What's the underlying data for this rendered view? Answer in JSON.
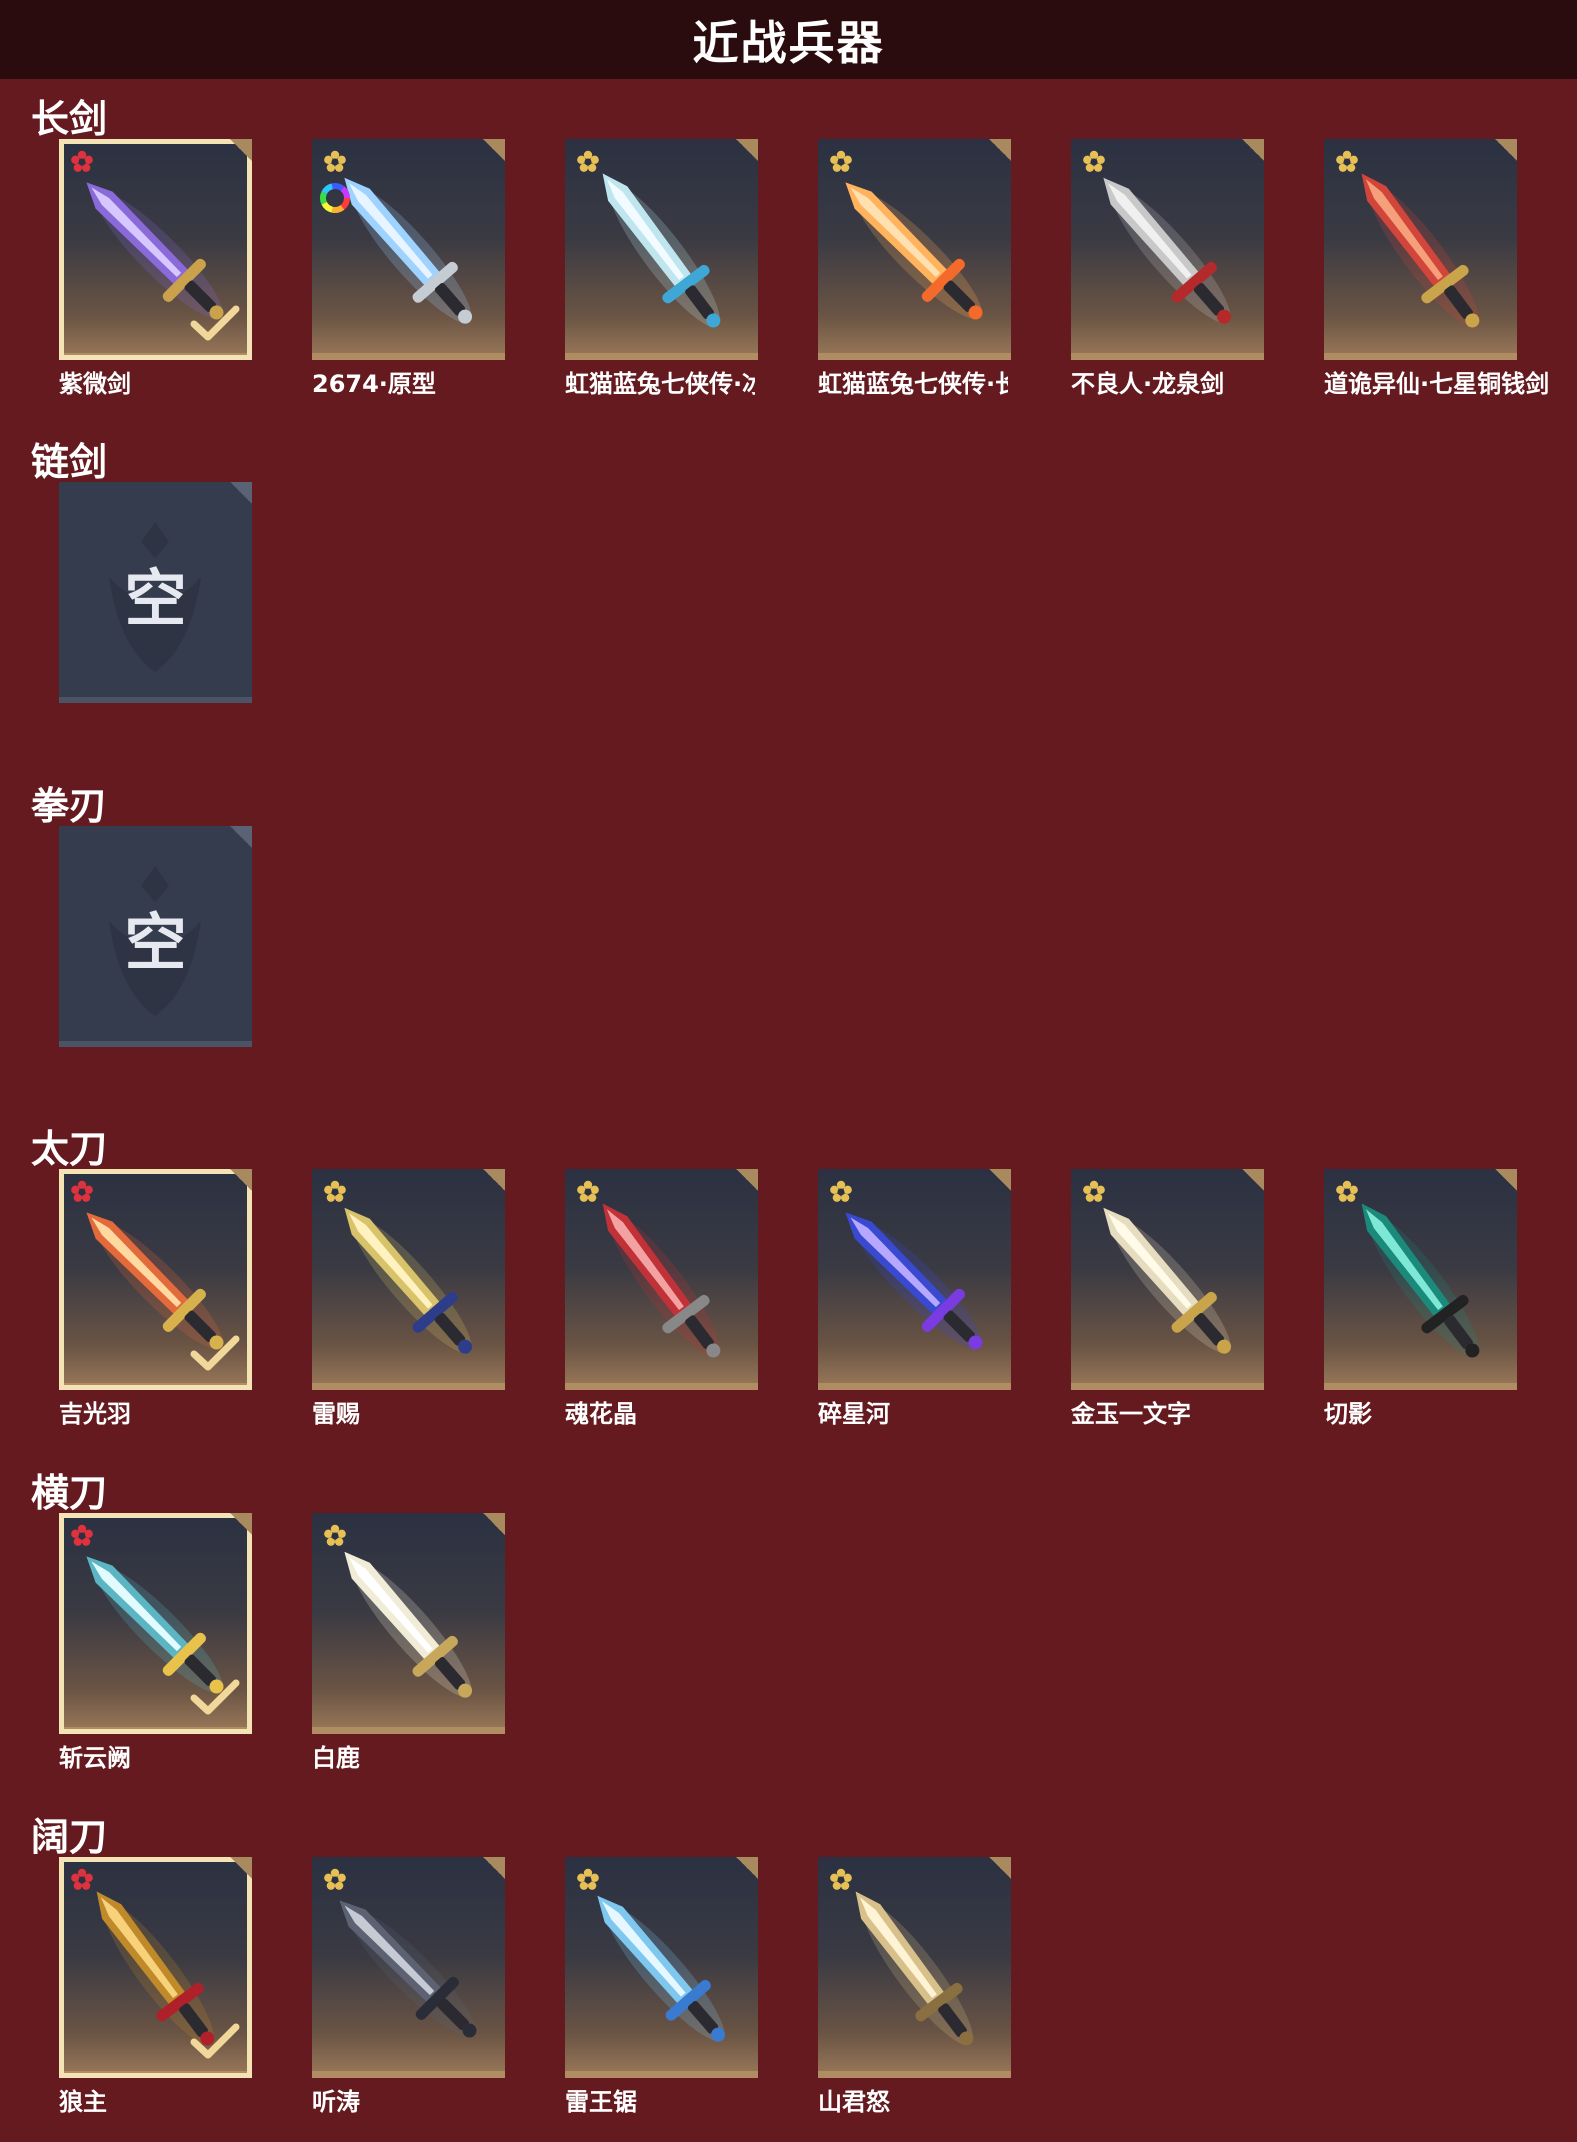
{
  "header": {
    "title": "近战兵器"
  },
  "colors": {
    "background": "#641a1f",
    "header": "#2b0c0e",
    "selected_frame": "#f4e3b5",
    "card_bottom": "#b08c62"
  },
  "sections": [
    {
      "title": "长剑",
      "items": [
        {
          "label": "紫微剑",
          "selected": true,
          "rank_icon": "red-flower-icon"
        },
        {
          "label": "2674·原型",
          "selected": false,
          "rank_icon": "gold-flower-icon",
          "has_color_wheel": true
        },
        {
          "label": "虹猫蓝兔七侠传·冰魄剑",
          "selected": false,
          "rank_icon": "gold-flower-icon"
        },
        {
          "label": "虹猫蓝兔七侠传·长虹剑",
          "selected": false,
          "rank_icon": "gold-flower-icon"
        },
        {
          "label": "不良人·龙泉剑",
          "selected": false,
          "rank_icon": "gold-flower-icon"
        },
        {
          "label": "道诡异仙·七星铜钱剑",
          "selected": false,
          "rank_icon": "gold-flower-icon"
        }
      ]
    },
    {
      "title": "链剑",
      "empty_label": "空",
      "items": []
    },
    {
      "title": "拳刃",
      "empty_label": "空",
      "items": []
    },
    {
      "title": "太刀",
      "items": [
        {
          "label": "吉光羽",
          "selected": true,
          "rank_icon": "red-flower-icon"
        },
        {
          "label": "雷赐",
          "selected": false,
          "rank_icon": "gold-flower-icon"
        },
        {
          "label": "魂花晶",
          "selected": false,
          "rank_icon": "gold-flower-icon"
        },
        {
          "label": "碎星河",
          "selected": false,
          "rank_icon": "gold-flower-icon"
        },
        {
          "label": "金玉一文字",
          "selected": false,
          "rank_icon": "gold-flower-icon"
        },
        {
          "label": "切影",
          "selected": false,
          "rank_icon": "gold-flower-icon"
        }
      ]
    },
    {
      "title": "横刀",
      "items": [
        {
          "label": "斩云阙",
          "selected": true,
          "rank_icon": "red-flower-icon"
        },
        {
          "label": "白鹿",
          "selected": false,
          "rank_icon": "gold-flower-icon"
        }
      ]
    },
    {
      "title": "阔刀",
      "items": [
        {
          "label": "狼主",
          "selected": true,
          "rank_icon": "red-flower-icon"
        },
        {
          "label": "听涛",
          "selected": false,
          "rank_icon": "gold-flower-icon"
        },
        {
          "label": "雷王锯",
          "selected": false,
          "rank_icon": "gold-flower-icon"
        },
        {
          "label": "山君怒",
          "selected": false,
          "rank_icon": "gold-flower-icon"
        }
      ]
    }
  ]
}
